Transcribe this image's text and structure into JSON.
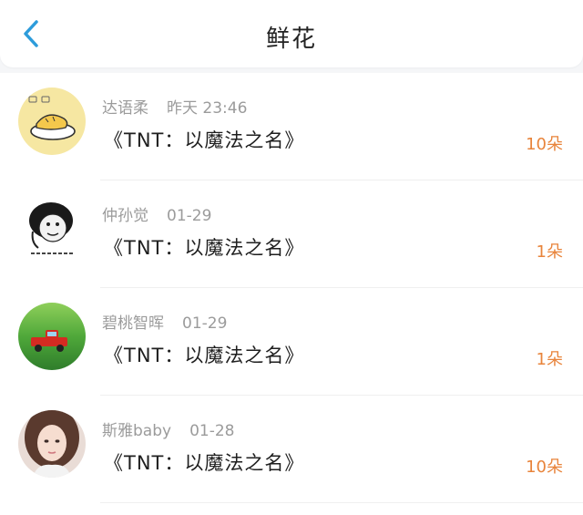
{
  "header": {
    "title": "鲜花",
    "back_icon": "chevron-left-icon"
  },
  "colors": {
    "accent": "#2d9cdb",
    "count": "#e8843b",
    "muted": "#9b9b9b"
  },
  "items": [
    {
      "user": "达语柔",
      "time": "昨天 23:46",
      "book": "《TNT：以魔法之名》",
      "count": "10朵",
      "avatar": "cartoon-sleep-avatar"
    },
    {
      "user": "仲孙觉",
      "time": "01-29",
      "book": "《TNT：以魔法之名》",
      "count": "1朵",
      "avatar": "meme-face-avatar"
    },
    {
      "user": "碧桃智晖",
      "time": "01-29",
      "book": "《TNT：以魔法之名》",
      "count": "1朵",
      "avatar": "red-car-grass-avatar"
    },
    {
      "user": "斯雅baby",
      "time": "01-28",
      "book": "《TNT：以魔法之名》",
      "count": "10朵",
      "avatar": "girl-portrait-avatar"
    }
  ]
}
